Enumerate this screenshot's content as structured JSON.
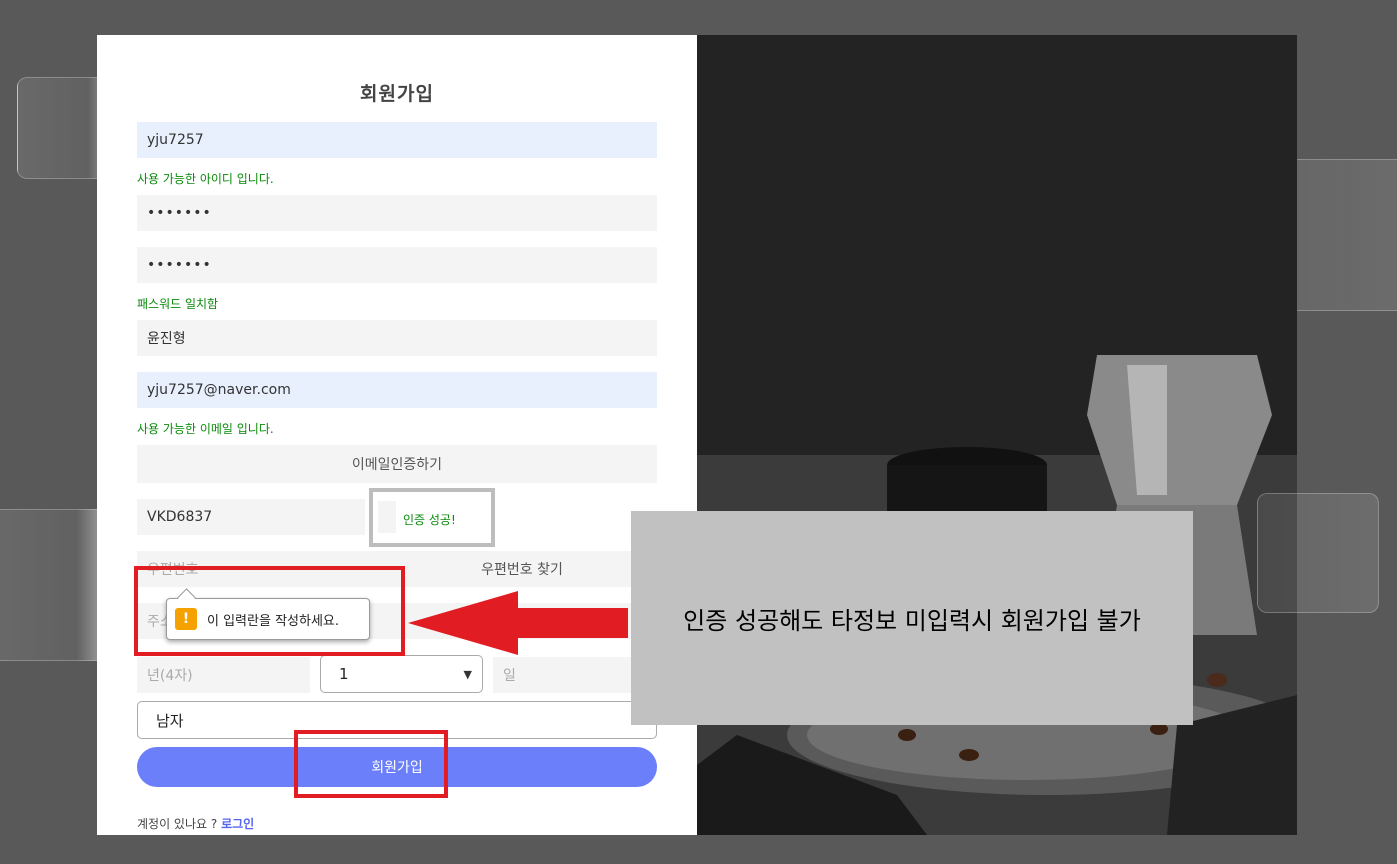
{
  "form": {
    "title": "회원가입",
    "userid_value": "yju7257",
    "userid_msg": "사용 가능한 아이디 입니다.",
    "password_value": "•••••••",
    "password_confirm_value": "•••••••",
    "password_msg": "패스워드 일치함",
    "name_value": "윤진형",
    "email_value": "yju7257@naver.com",
    "email_msg": "사용 가능한 이메일 입니다.",
    "email_verify_button": "이메일인증하기",
    "verify_code_value": "VKD6837",
    "verify_result": "인증 성공!",
    "postcode_placeholder": "우편번호",
    "postcode_button": "우편번호 찾기",
    "address_placeholder": "주소",
    "year_placeholder": "년(4자)",
    "month_value": "1",
    "day_placeholder": "일",
    "gender_value": "남자",
    "submit_label": "회원가입",
    "footer_text": "계정이 있나요 ?",
    "login_link": "로그인"
  },
  "tooltip": {
    "icon": "warning-icon",
    "text": "이 입력란을 작성하세요."
  },
  "annotation": {
    "text": "인증 성공해도 타정보 미입력시 회원가입 불가"
  },
  "colors": {
    "submit": "#6c7ffb",
    "highlight_red": "#e21c23",
    "success_green": "#0a8a0a"
  }
}
